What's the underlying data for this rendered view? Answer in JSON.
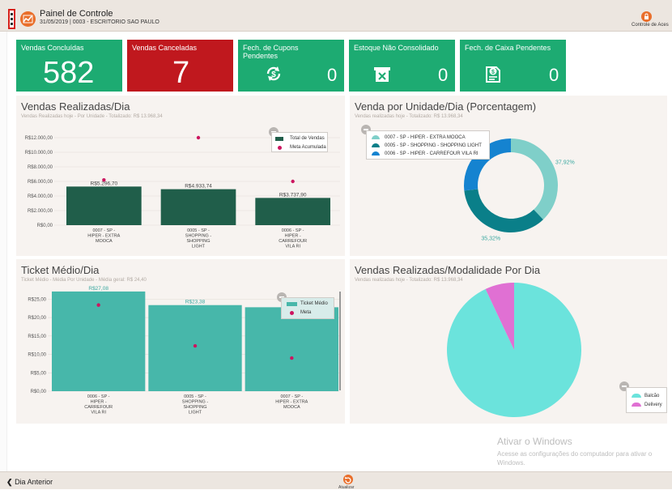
{
  "header": {
    "title": "Painel de Controle",
    "subtitle": "31/05/2019 | 0003 - ESCRITORIO SAO PAULO",
    "user_label": "Controle de Aces"
  },
  "kpis": [
    {
      "label": "Vendas Concluídas",
      "value": "582",
      "color": "#1dab72"
    },
    {
      "label": "Vendas Canceladas",
      "value": "7",
      "color": "#c0181e"
    },
    {
      "label": "Fech. de Cupons Pendentes",
      "value": "0",
      "color": "#1dab72",
      "icon": "refresh-dollar-icon"
    },
    {
      "label": "Estoque Não Consolidado",
      "value": "0",
      "color": "#1dab72",
      "icon": "box-x-icon"
    },
    {
      "label": "Fech. de Caixa Pendentes",
      "value": "0",
      "color": "#1dab72",
      "icon": "document-dollar-icon"
    }
  ],
  "panels": {
    "vendas_dia": {
      "title": "Vendas Realizadas/Dia",
      "subtitle": "Vendas Realizadas hoje - Por Unidade - Totalizado: R$ 13.968,34"
    },
    "venda_unidade": {
      "title": "Venda por Unidade/Dia (Porcentagem)",
      "subtitle": "Vendas realizadas hoje - Totalizado: R$ 13.968,34"
    },
    "ticket": {
      "title": "Ticket Médio/Dia",
      "subtitle": "Ticket Médio - Média Por Unidade - Média geral: R$ 24,40"
    },
    "modalidade": {
      "title": "Vendas Realizadas/Modalidade Por Dia",
      "subtitle": "Vendas realizadas hoje - Totalizado: R$ 13.968,34"
    }
  },
  "chart_data": [
    {
      "id": "vendas_dia",
      "type": "bar",
      "categories": [
        "0007 - SP - HIPER - EXTRA MOOCA",
        "0005 - SP - SHOPPING - SHOPPING LIGHT",
        "0006 - SP - HIPER - CARREFOUR VILA RI"
      ],
      "category_lines": [
        [
          "0007 - SP -",
          "HIPER - EXTRA",
          "MOOCA"
        ],
        [
          "0005 - SP -",
          "SHOPPING -",
          "SHOPPING",
          "LIGHT"
        ],
        [
          "0006 - SP -",
          "HIPER -",
          "CARREFOUR",
          "VILA RI"
        ]
      ],
      "series": [
        {
          "name": "Total de Vendas",
          "values": [
            5296.7,
            4933.74,
            3737.9
          ],
          "labels": [
            "R$5.296,70",
            "R$4.933,74",
            "R$3.737,90"
          ],
          "color": "#205e4a"
        },
        {
          "name": "Meta Acumulada",
          "values": [
            6200,
            12000,
            6000
          ],
          "color": "#cc1660",
          "type": "scatter"
        }
      ],
      "ylim": [
        0,
        12000
      ],
      "yticks": [
        0,
        2000,
        4000,
        6000,
        8000,
        10000,
        12000
      ],
      "ytick_labels": [
        "R$0,00",
        "R$2.000,00",
        "R$4.000,00",
        "R$6.000,00",
        "R$8.000,00",
        "R$10.000,00",
        "R$12.000,00"
      ],
      "legend": "top-right"
    },
    {
      "id": "venda_unidade",
      "type": "pie",
      "donut": true,
      "series": [
        {
          "name": "0007 - SP - HIPER - EXTRA MOOCA",
          "value": 37.92,
          "label": "37,92%",
          "color": "#7fcfc9"
        },
        {
          "name": "0005 - SP - SHOPPING - SHOPPING LIGHT",
          "value": 35.32,
          "label": "35,32%",
          "color": "#0a7f89"
        },
        {
          "name": "0006 - SP - HIPER - CARREFOUR VILA RI",
          "value": 26.76,
          "color": "#1583d0"
        }
      ],
      "legend": "top-left"
    },
    {
      "id": "ticket",
      "type": "bar",
      "categories": [
        "0006 - SP - HIPER - CARREFOUR VILA RI",
        "0005 - SP - SHOPPING - SHOPPING LIGHT",
        "0007 - SP - HIPER - EXTRA MOOCA"
      ],
      "category_lines": [
        [
          "0006 - SP -",
          "HIPER -",
          "CARREFOUR",
          "VILA RI"
        ],
        [
          "0005 - SP -",
          "SHOPPING -",
          "SHOPPING",
          "LIGHT"
        ],
        [
          "0007 - SP -",
          "HIPER - EXTRA",
          "MOOCA"
        ]
      ],
      "series": [
        {
          "name": "Ticket Médio",
          "values": [
            27.08,
            23.38,
            22.8
          ],
          "labels": [
            "R$27,08",
            "R$23,38",
            ""
          ],
          "color": "#47b7aa"
        },
        {
          "name": "Meta",
          "values": [
            23.4,
            12.3,
            9.0
          ],
          "color": "#cc1660",
          "type": "scatter"
        }
      ],
      "ylim": [
        0,
        27.5
      ],
      "yticks": [
        0,
        5,
        10,
        15,
        20,
        25
      ],
      "ytick_labels": [
        "R$0,00",
        "R$5,00",
        "R$10,00",
        "R$15,00",
        "R$20,00",
        "R$25,00"
      ],
      "legend": "top-right"
    },
    {
      "id": "modalidade",
      "type": "pie",
      "series": [
        {
          "name": "Balcão",
          "value": 93,
          "color": "#6be3dc"
        },
        {
          "name": "Delivery",
          "value": 7,
          "color": "#e070d3"
        }
      ],
      "legend": "bottom-right"
    }
  ],
  "footer": {
    "prev_label": "Dia Anterior",
    "refresh_label": "Atualizar"
  },
  "watermark": {
    "title": "Ativar o Windows",
    "text": "Acesse as configurações do computador para ativar o Windows."
  }
}
